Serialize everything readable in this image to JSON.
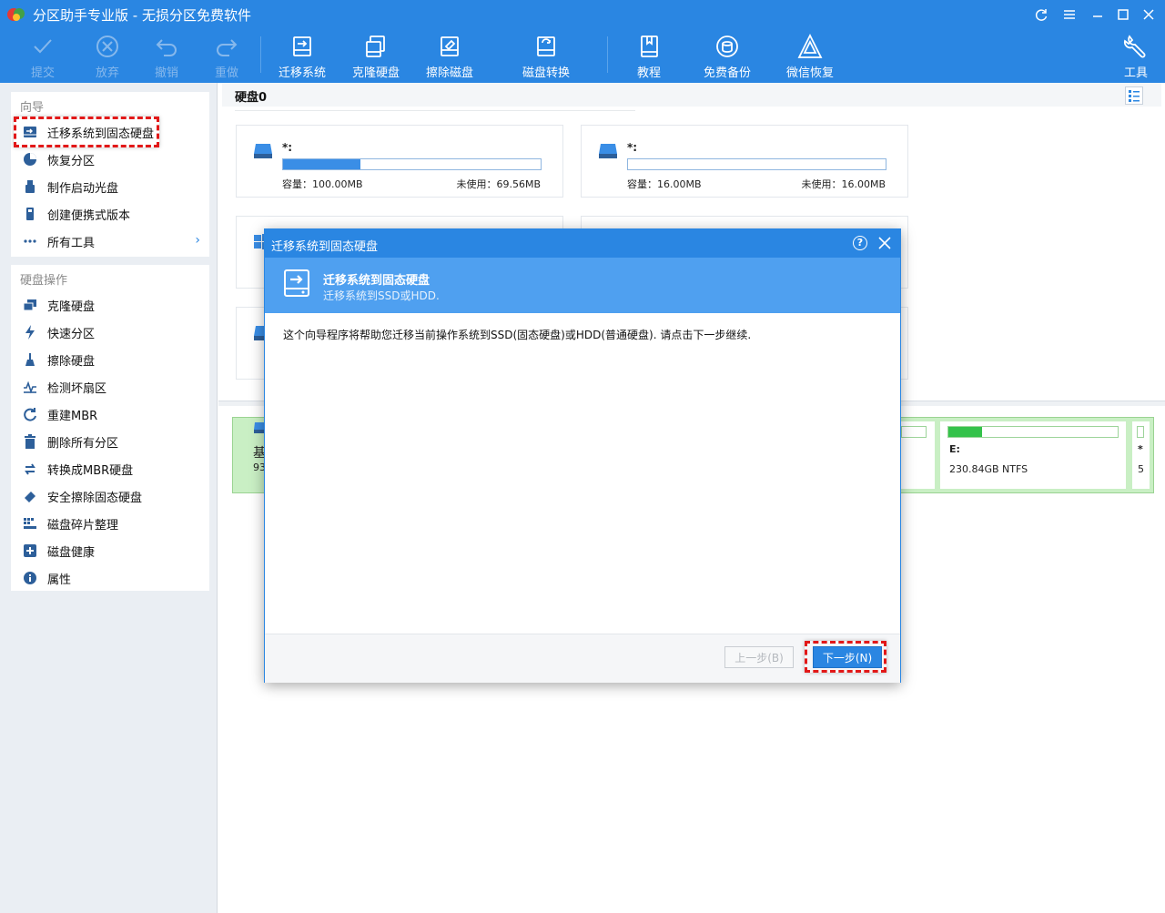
{
  "window": {
    "title": "分区助手专业版 - 无损分区免费软件"
  },
  "toolbar": {
    "commit": "提交",
    "discard": "放弃",
    "undo": "撤销",
    "redo": "重做",
    "migrate_os": "迁移系统",
    "clone_disk": "克隆硬盘",
    "wipe_disk": "擦除磁盘",
    "disk_convert": "磁盘转换",
    "tutorial": "教程",
    "free_backup": "免费备份",
    "wechat_recovery": "微信恢复",
    "tools": "工具"
  },
  "sidebar": {
    "wizard_title": "向导",
    "wizard_items": [
      {
        "label": "迁移系统到固态硬盘",
        "icon": "disk-migrate-icon"
      },
      {
        "label": "恢复分区",
        "icon": "pie-icon"
      },
      {
        "label": "制作启动光盘",
        "icon": "usb-icon"
      },
      {
        "label": "创建便携式版本",
        "icon": "portable-icon"
      },
      {
        "label": "所有工具",
        "icon": "dots-icon"
      }
    ],
    "disk_ops_title": "硬盘操作",
    "disk_ops_items": [
      {
        "label": "克隆硬盘",
        "icon": "clone-icon"
      },
      {
        "label": "快速分区",
        "icon": "lightning-icon"
      },
      {
        "label": "擦除硬盘",
        "icon": "broom-icon"
      },
      {
        "label": "检测坏扇区",
        "icon": "pulse-icon"
      },
      {
        "label": "重建MBR",
        "icon": "rebuild-icon"
      },
      {
        "label": "删除所有分区",
        "icon": "trash-icon"
      },
      {
        "label": "转换成MBR硬盘",
        "icon": "convert-icon"
      },
      {
        "label": "安全擦除固态硬盘",
        "icon": "eraser-icon"
      },
      {
        "label": "磁盘碎片整理",
        "icon": "defrag-icon"
      },
      {
        "label": "磁盘健康",
        "icon": "health-icon"
      },
      {
        "label": "属性",
        "icon": "info-icon"
      }
    ]
  },
  "main": {
    "disk_label": "硬盘0",
    "partitions": [
      {
        "name": "*:",
        "capacity": "容量：100.00MB",
        "unused": "未使用：69.56MB",
        "used_fraction": 0.3
      },
      {
        "name": "*:",
        "capacity": "容量：16.00MB",
        "unused": "未使用：16.00MB",
        "used_fraction": 0.0
      }
    ],
    "diskmap": {
      "disk_type_partial": "基",
      "disk_size_partial": "93",
      "drive_e": "E:",
      "drive_e_info": "230.84GB NTFS",
      "drive_e_used_fraction": 0.2,
      "last_part_name": "*",
      "last_part_info": "5"
    }
  },
  "dialog": {
    "title": "迁移系统到固态硬盘",
    "help": "?",
    "heading": "迁移系统到固态硬盘",
    "subheading": "迁移系统到SSD或HDD.",
    "body": "这个向导程序将帮助您迁移当前操作系统到SSD(固态硬盘)或HDD(普通硬盘). 请点击下一步继续.",
    "prev_label": "上一步(B)",
    "next_label": "下一步(N)"
  },
  "colors": {
    "brand": "#2a86e2",
    "banner": "#4fa0f0",
    "highlight": "#e21818",
    "disk_green": "#34c24a"
  }
}
